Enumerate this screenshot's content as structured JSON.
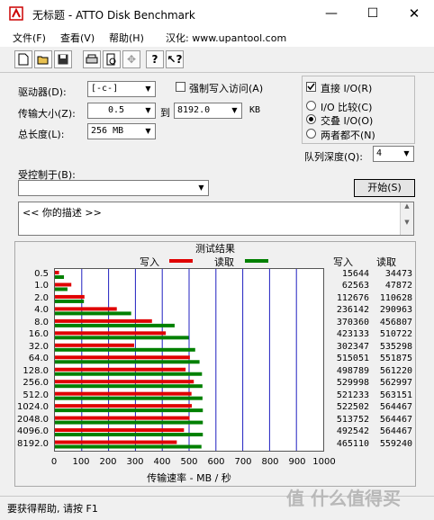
{
  "window": {
    "title": "无标题 - ATTO Disk Benchmark",
    "min": "—",
    "max": "☐",
    "close": "✕"
  },
  "menu": [
    {
      "label": "文件(F)"
    },
    {
      "label": "查看(V)"
    },
    {
      "label": "帮助(H)"
    },
    {
      "label": "汉化: www.upantool.com"
    }
  ],
  "toolbar": {
    "icons": [
      "new-file-icon",
      "open-folder-icon",
      "save-icon",
      "print-icon",
      "print-preview-icon",
      "move-icon",
      "help-icon",
      "context-help-icon"
    ]
  },
  "controls": {
    "drive_label": "驱动器(D):",
    "drive_value": "[-c-]",
    "force_write_label": "强制写入访问(A)",
    "direct_io_label": "直接 I/O(R)",
    "transfer_label": "传输大小(Z):",
    "transfer_from": "0.5",
    "to_label": "到",
    "transfer_to": "8192.0",
    "kb_label": "KB",
    "total_label": "总长度(L):",
    "total_value": "256 MB",
    "io_compare_label": "I/O 比较(C)",
    "overlap_label": "交叠 I/O(O)",
    "neither_label": "两者都不(N)",
    "queue_label": "队列深度(Q):",
    "queue_value": "4",
    "controlled_label": "受控制于(B):",
    "start_button": "开始(S)",
    "description": "<<   你的描述   >>"
  },
  "results": {
    "title": "测试结果",
    "write_legend": "写入",
    "read_legend": "读取",
    "col_write": "写入",
    "col_read": "读取"
  },
  "chart_data": {
    "type": "bar",
    "orientation": "horizontal",
    "title": "测试结果",
    "xlabel": "传输速率 - MB / 秒",
    "xlim": [
      0,
      1000
    ],
    "xticks": [
      "0",
      "100",
      "200",
      "300",
      "400",
      "500",
      "600",
      "700",
      "800",
      "900",
      "1000"
    ],
    "categories": [
      "0.5",
      "1.0",
      "2.0",
      "4.0",
      "8.0",
      "16.0",
      "32.0",
      "64.0",
      "128.0",
      "256.0",
      "512.0",
      "1024.0",
      "2048.0",
      "4096.0",
      "8192.0"
    ],
    "series": [
      {
        "name": "写入",
        "color": "#e00000",
        "values": [
          15644,
          62563,
          112676,
          236142,
          370360,
          423133,
          302347,
          515051,
          498789,
          529998,
          521233,
          522502,
          513752,
          492542,
          465110
        ]
      },
      {
        "name": "读取",
        "color": "#008000",
        "values": [
          34473,
          47872,
          110628,
          290963,
          456807,
          510722,
          535298,
          551875,
          561220,
          562997,
          563151,
          564467,
          564467,
          564467,
          559240
        ]
      }
    ],
    "write_text": [
      "15644",
      "62563",
      "112676",
      "236142",
      "370360",
      "423133",
      "302347",
      "515051",
      "498789",
      "529998",
      "521233",
      "522502",
      "513752",
      "492542",
      "465110"
    ],
    "read_text": [
      "34473",
      "47872",
      "110628",
      "290963",
      "456807",
      "510722",
      "535298",
      "551875",
      "561220",
      "562997",
      "563151",
      "564467",
      "564467",
      "564467",
      "559240"
    ]
  },
  "status": {
    "text": "要获得帮助, 请按 F1",
    "watermark": "值 什么值得买"
  }
}
